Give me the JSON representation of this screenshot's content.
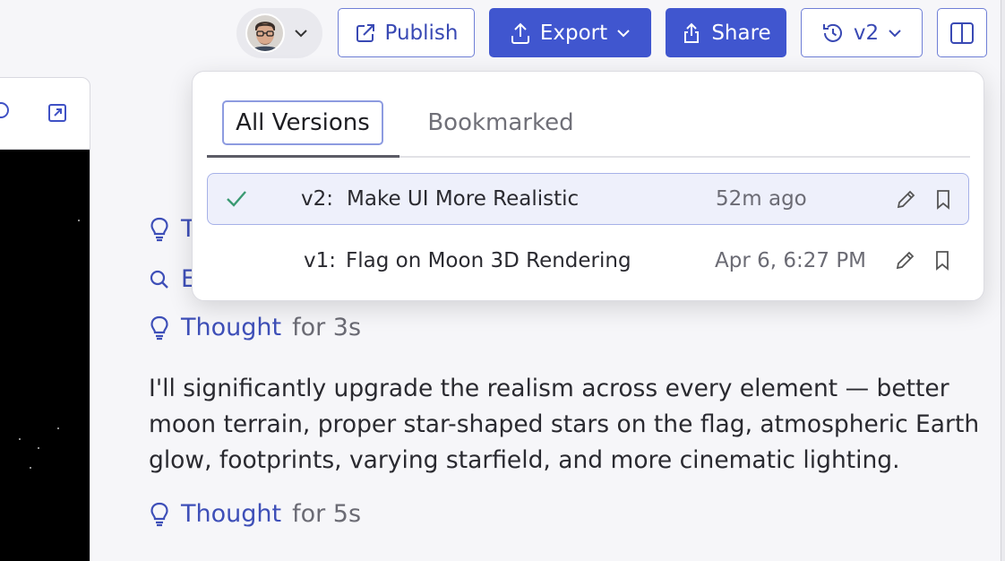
{
  "topbar": {
    "publish_label": "Publish",
    "export_label": "Export",
    "share_label": "Share",
    "version_label": "v2"
  },
  "versions": {
    "tabs": [
      "All Versions",
      "Bookmarked"
    ],
    "items": [
      {
        "num": "v2:",
        "title": "Make UI More Realistic",
        "time": "52m ago",
        "selected": true
      },
      {
        "num": "v1:",
        "title": "Flag on Moon 3D Rendering",
        "time": "Apr 6, 6:27 PM",
        "selected": false
      }
    ]
  },
  "chat": {
    "partial_1": "T",
    "partial_2": "E",
    "thought_1": {
      "link": "Thought",
      "duration": "for 3s"
    },
    "message": "I'll significantly upgrade the realism across every element — better moon terrain, proper star-shaped stars on the flag, atmospheric Earth glow, footprints, varying starfield, and more cinematic lighting.",
    "thought_2": {
      "link": "Thought",
      "duration": "for 5s"
    }
  },
  "colors": {
    "accent": "#4056cf",
    "link": "#3e4fb8",
    "check": "#3a9a72"
  }
}
